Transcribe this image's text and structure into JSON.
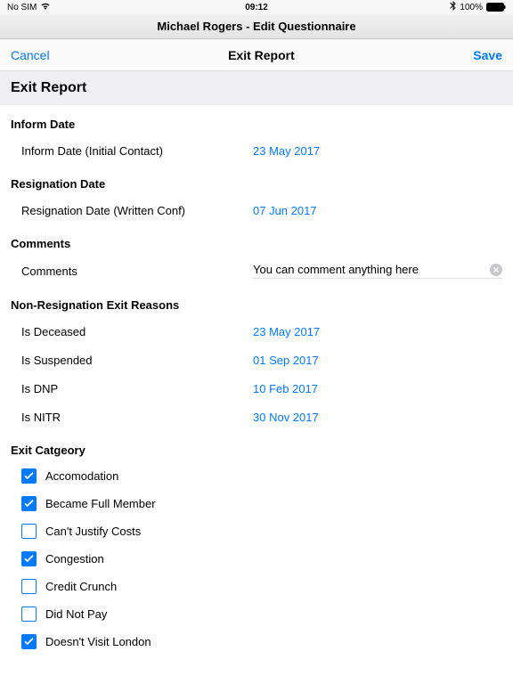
{
  "status": {
    "carrier": "No SIM",
    "wifi": "wifi",
    "time": "09:12",
    "bluetooth": "bluetooth",
    "battery_pct": "100%"
  },
  "title_bar": "Michael Rogers - Edit Questionnaire",
  "nav": {
    "cancel": "Cancel",
    "title": "Exit Report",
    "save": "Save"
  },
  "section_title": "Exit Report",
  "groups": {
    "inform_date": {
      "label": "Inform Date",
      "row_label": "Inform Date (Initial Contact)",
      "row_value": "23 May 2017"
    },
    "resignation_date": {
      "label": "Resignation Date",
      "row_label": "Resignation Date (Written Conf)",
      "row_value": "07 Jun 2017"
    },
    "comments": {
      "label": "Comments",
      "row_label": "Comments",
      "value": "You can comment anything here"
    },
    "non_resignation": {
      "label": "Non-Resignation Exit Reasons",
      "items": [
        {
          "label": "Is Deceased",
          "value": "23 May 2017"
        },
        {
          "label": "Is Suspended",
          "value": "01 Sep 2017"
        },
        {
          "label": "Is DNP",
          "value": "10 Feb 2017"
        },
        {
          "label": "Is NITR",
          "value": "30 Nov 2017"
        }
      ]
    },
    "exit_category": {
      "label": "Exit Catgeory",
      "items": [
        {
          "label": "Accomodation",
          "checked": true
        },
        {
          "label": "Became Full Member",
          "checked": true
        },
        {
          "label": "Can't Justify Costs",
          "checked": false
        },
        {
          "label": "Congestion",
          "checked": true
        },
        {
          "label": "Credit Crunch",
          "checked": false
        },
        {
          "label": "Did Not Pay",
          "checked": false
        },
        {
          "label": "Doesn't Visit London",
          "checked": true
        }
      ]
    }
  }
}
